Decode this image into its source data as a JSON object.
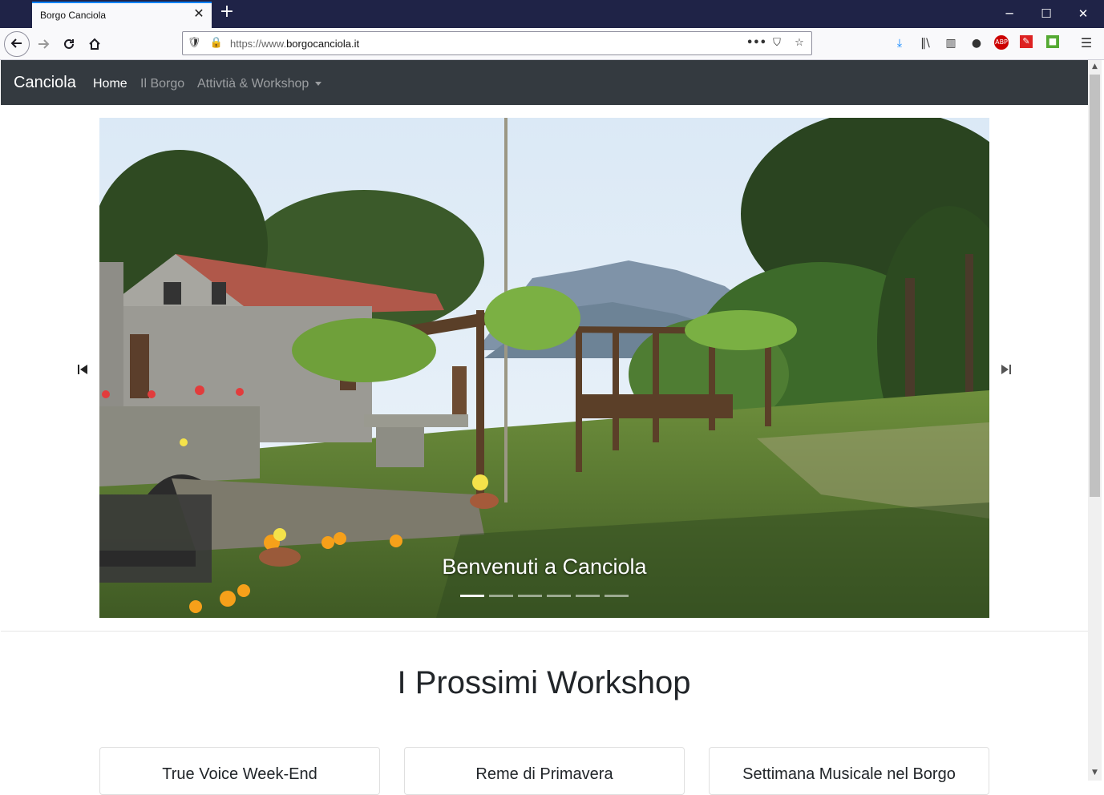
{
  "browser": {
    "tab_title": "Borgo Canciola",
    "url_prefix": "https://www.",
    "url_domain": "borgocanciola.it"
  },
  "site": {
    "brand": "Canciola",
    "nav": [
      "Home",
      "Il Borgo",
      "Attivtià & Workshop"
    ],
    "active_index": 0
  },
  "hero": {
    "caption": "Benvenuti a Canciola",
    "slide_count": 6,
    "active_slide": 0
  },
  "workshops": {
    "title": "I Prossimi Workshop",
    "cards": [
      "True Voice Week-End",
      "Reme di Primavera",
      "Settimana Musicale nel Borgo"
    ]
  },
  "icons": {
    "back": "arrow-left-icon",
    "forward": "arrow-right-icon",
    "reload": "reload-icon",
    "home": "home-icon",
    "prev": "skip-previous-icon",
    "next": "skip-next-icon"
  }
}
